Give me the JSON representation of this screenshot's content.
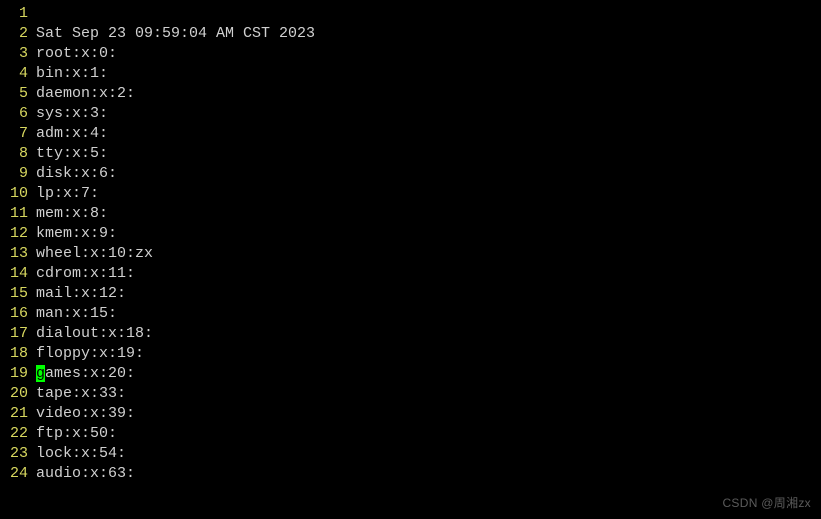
{
  "cursor_line": 19,
  "cursor_col": 0,
  "lines": [
    {
      "num": 1,
      "text": ""
    },
    {
      "num": 2,
      "text": "Sat Sep 23 09:59:04 AM CST 2023"
    },
    {
      "num": 3,
      "text": "root:x:0:"
    },
    {
      "num": 4,
      "text": "bin:x:1:"
    },
    {
      "num": 5,
      "text": "daemon:x:2:"
    },
    {
      "num": 6,
      "text": "sys:x:3:"
    },
    {
      "num": 7,
      "text": "adm:x:4:"
    },
    {
      "num": 8,
      "text": "tty:x:5:"
    },
    {
      "num": 9,
      "text": "disk:x:6:"
    },
    {
      "num": 10,
      "text": "lp:x:7:"
    },
    {
      "num": 11,
      "text": "mem:x:8:"
    },
    {
      "num": 12,
      "text": "kmem:x:9:"
    },
    {
      "num": 13,
      "text": "wheel:x:10:zx"
    },
    {
      "num": 14,
      "text": "cdrom:x:11:"
    },
    {
      "num": 15,
      "text": "mail:x:12:"
    },
    {
      "num": 16,
      "text": "man:x:15:"
    },
    {
      "num": 17,
      "text": "dialout:x:18:"
    },
    {
      "num": 18,
      "text": "floppy:x:19:"
    },
    {
      "num": 19,
      "text": "games:x:20:"
    },
    {
      "num": 20,
      "text": "tape:x:33:"
    },
    {
      "num": 21,
      "text": "video:x:39:"
    },
    {
      "num": 22,
      "text": "ftp:x:50:"
    },
    {
      "num": 23,
      "text": "lock:x:54:"
    },
    {
      "num": 24,
      "text": "audio:x:63:"
    }
  ],
  "watermark": "CSDN @周湘zx"
}
